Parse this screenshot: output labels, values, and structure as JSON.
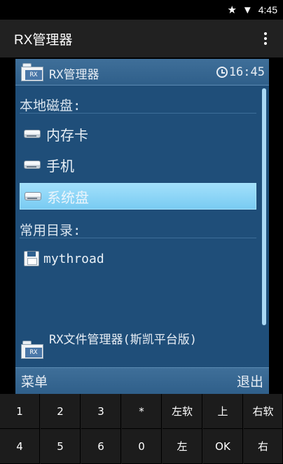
{
  "status_bar": {
    "star_icon": "★",
    "wifi_icon": "▼",
    "time": "4:45"
  },
  "app_bar": {
    "title": "RX管理器",
    "menu_icon": "overflow-menu-icon"
  },
  "emulator": {
    "title": "RX管理器",
    "folder_badge": "RX",
    "clock": "16:45",
    "sections": {
      "local_disks": "本地磁盘:",
      "common_dirs": "常用目录:"
    },
    "disks": [
      {
        "label": "内存卡"
      },
      {
        "label": "手机"
      },
      {
        "label": "系统盘"
      }
    ],
    "directories": [
      {
        "label": "mythroad"
      }
    ],
    "footer_note": "RX文件管理器(斯凯平台版)",
    "softkeys": {
      "left": "菜单",
      "right": "退出"
    }
  },
  "keypad": {
    "row1": [
      "1",
      "2",
      "3",
      "*",
      "左软",
      "上",
      "右软"
    ],
    "row2": [
      "4",
      "5",
      "6",
      "0",
      "左",
      "OK",
      "右"
    ]
  },
  "colors": {
    "emulator_bg": "#1f4e79",
    "selection": "#79cbf2",
    "keypad_bg": "#1c1c1c"
  }
}
